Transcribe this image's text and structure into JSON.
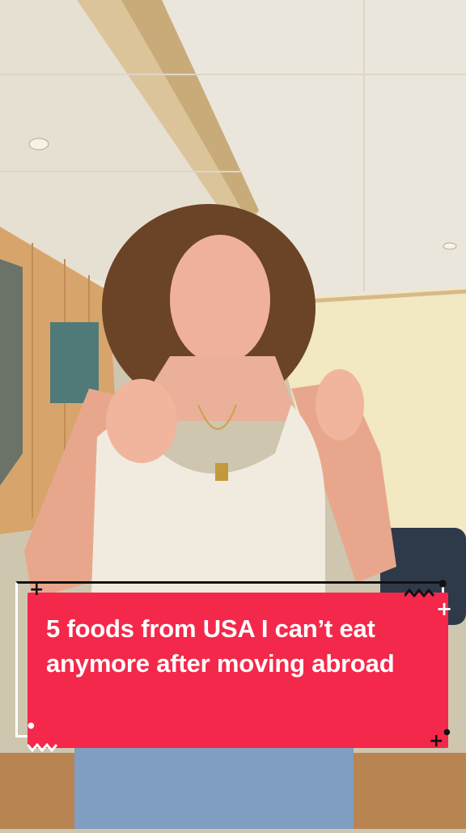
{
  "caption": {
    "text": "5 foods from USA I can’t eat anymore after moving abroad"
  },
  "colors": {
    "accent": "#f4284a",
    "frame": "#ffffff",
    "wall": "#f1e6bf",
    "ceiling": "#e9e3d7",
    "wood": "#d9a872"
  },
  "icons": {
    "plus": "+",
    "zigzag": "wavy-line",
    "dot": "dot"
  }
}
